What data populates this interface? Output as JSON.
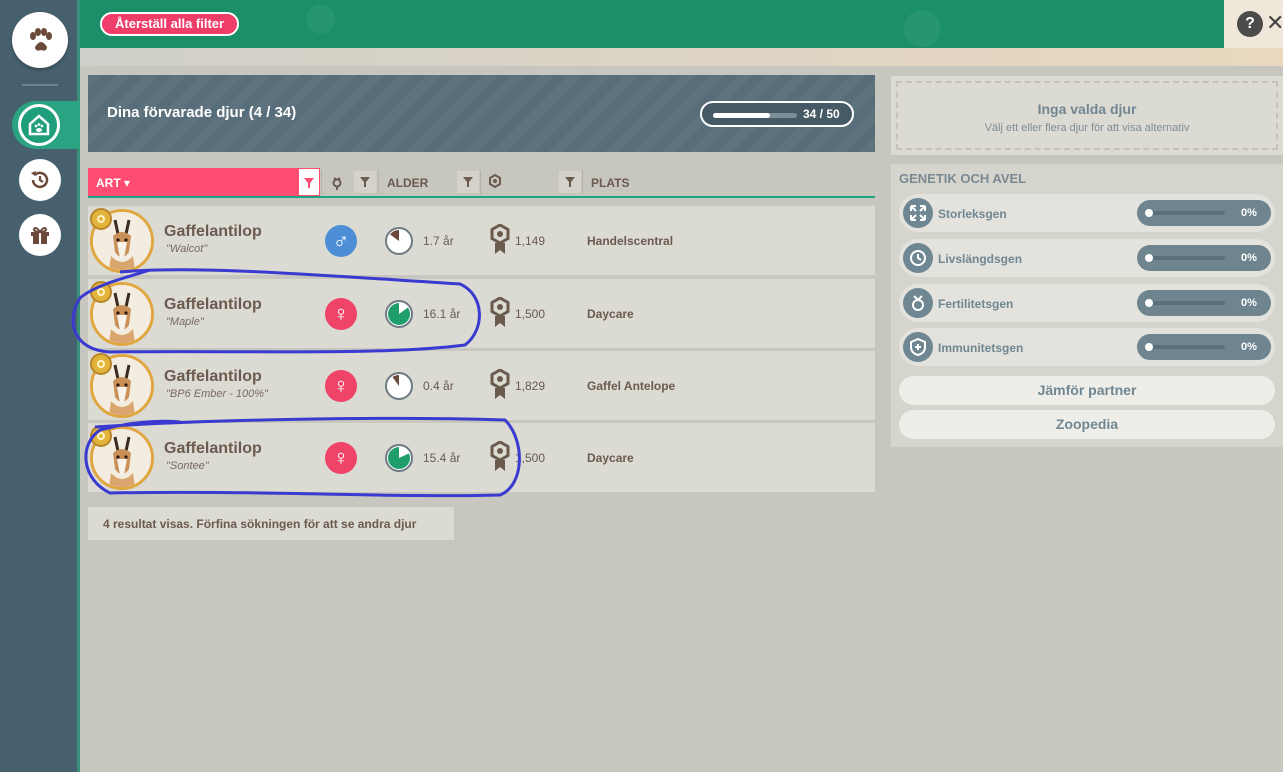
{
  "sidebar": {
    "buttons": [
      {
        "name": "paw",
        "icon": "paw-icon"
      },
      {
        "name": "storage",
        "icon": "house-paw-icon",
        "active": true
      },
      {
        "name": "history",
        "icon": "history-icon"
      },
      {
        "name": "gift",
        "icon": "gift-icon"
      }
    ]
  },
  "toolbar": {
    "reset_label": "Återställ alla filter",
    "help_label": "?",
    "close_label": "✕"
  },
  "storage": {
    "title": "Dina förvarade djur (4 / 34)",
    "capacity_label": "34 / 50",
    "capacity_used": 34,
    "capacity_max": 50
  },
  "table": {
    "col_species": "ART ▾",
    "col_age": "ALDER",
    "col_place": "PLATS",
    "rows": [
      {
        "species": "Gaffelantilop",
        "nickname": "\"Walcot\"",
        "gender": "male",
        "gender_symbol": "♂",
        "age": "1.7 år",
        "age_fraction": 0.15,
        "score": "1,149",
        "place": "Handelscentral"
      },
      {
        "species": "Gaffelantilop",
        "nickname": "\"Maple\"",
        "gender": "female",
        "gender_symbol": "♀",
        "age": "16.1 år",
        "age_fraction": 0.85,
        "score": "1,500",
        "place": "Daycare"
      },
      {
        "species": "Gaffelantilop",
        "nickname": "\"BP6 Ember - 100%\"",
        "gender": "female",
        "gender_symbol": "♀",
        "age": "0.4 år",
        "age_fraction": 0.1,
        "score": "1,829",
        "place": "Gaffel Antelope"
      },
      {
        "species": "Gaffelantilop",
        "nickname": "\"Sontee\"",
        "gender": "female",
        "gender_symbol": "♀",
        "age": "15.4 år",
        "age_fraction": 0.82,
        "score": "1,500",
        "place": "Daycare"
      }
    ],
    "result_note": "4 resultat visas. Förfina sökningen för att se andra djur"
  },
  "selection": {
    "title": "Inga valda djur",
    "subtitle": "Välj ett eller flera djur för att visa alternativ"
  },
  "genetics": {
    "title": "GENETIK OCH AVEL",
    "rows": [
      {
        "label": "Storleksgen",
        "value": "0%",
        "icon": "expand-arrows-icon"
      },
      {
        "label": "Livslängdsgen",
        "value": "0%",
        "icon": "clock-icon"
      },
      {
        "label": "Fertilitetsgen",
        "value": "0%",
        "icon": "fertility-icon"
      },
      {
        "label": "Immunitetsgen",
        "value": "0%",
        "icon": "shield-cross-icon"
      }
    ],
    "compare_label": "Jämför partner",
    "zoopedia_label": "Zoopedia"
  },
  "colors": {
    "accent_pink": "#ff4c73",
    "accent_green": "#1b8f68",
    "annotation_blue": "#3a3ad0"
  }
}
